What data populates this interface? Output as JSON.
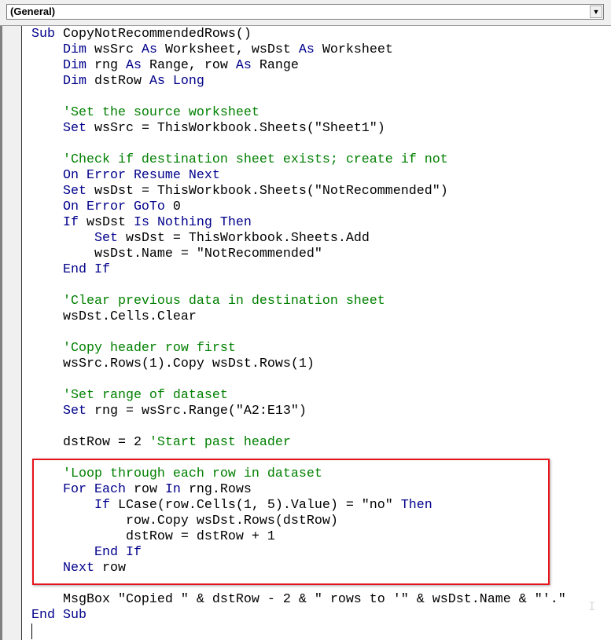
{
  "procedure_dropdown": {
    "selected": "(General)"
  },
  "code_lines": [
    [
      {
        "t": "Sub ",
        "c": "kw"
      },
      {
        "t": "CopyNotRecommendedRows()",
        "c": "tx"
      }
    ],
    [
      {
        "t": "    Dim ",
        "c": "kw"
      },
      {
        "t": "wsSrc ",
        "c": "tx"
      },
      {
        "t": "As ",
        "c": "kw"
      },
      {
        "t": "Worksheet, wsDst ",
        "c": "tx"
      },
      {
        "t": "As ",
        "c": "kw"
      },
      {
        "t": "Worksheet",
        "c": "tx"
      }
    ],
    [
      {
        "t": "    Dim ",
        "c": "kw"
      },
      {
        "t": "rng ",
        "c": "tx"
      },
      {
        "t": "As ",
        "c": "kw"
      },
      {
        "t": "Range, row ",
        "c": "tx"
      },
      {
        "t": "As ",
        "c": "kw"
      },
      {
        "t": "Range",
        "c": "tx"
      }
    ],
    [
      {
        "t": "    Dim ",
        "c": "kw"
      },
      {
        "t": "dstRow ",
        "c": "tx"
      },
      {
        "t": "As Long",
        "c": "kw"
      }
    ],
    [],
    [
      {
        "t": "    'Set the source worksheet",
        "c": "cm"
      }
    ],
    [
      {
        "t": "    Set ",
        "c": "kw"
      },
      {
        "t": "wsSrc = ThisWorkbook.Sheets(\"Sheet1\")",
        "c": "tx"
      }
    ],
    [],
    [
      {
        "t": "    'Check if destination sheet exists; create if not",
        "c": "cm"
      }
    ],
    [
      {
        "t": "    On Error Resume Next",
        "c": "kw"
      }
    ],
    [
      {
        "t": "    Set ",
        "c": "kw"
      },
      {
        "t": "wsDst = ThisWorkbook.Sheets(\"NotRecommended\")",
        "c": "tx"
      }
    ],
    [
      {
        "t": "    On Error GoTo ",
        "c": "kw"
      },
      {
        "t": "0",
        "c": "tx"
      }
    ],
    [
      {
        "t": "    If ",
        "c": "kw"
      },
      {
        "t": "wsDst ",
        "c": "tx"
      },
      {
        "t": "Is Nothing Then",
        "c": "kw"
      }
    ],
    [
      {
        "t": "        Set ",
        "c": "kw"
      },
      {
        "t": "wsDst = ThisWorkbook.Sheets.Add",
        "c": "tx"
      }
    ],
    [
      {
        "t": "        wsDst.Name = \"NotRecommended\"",
        "c": "tx"
      }
    ],
    [
      {
        "t": "    End If",
        "c": "kw"
      }
    ],
    [],
    [
      {
        "t": "    'Clear previous data in destination sheet",
        "c": "cm"
      }
    ],
    [
      {
        "t": "    wsDst.Cells.Clear",
        "c": "tx"
      }
    ],
    [],
    [
      {
        "t": "    'Copy header row first",
        "c": "cm"
      }
    ],
    [
      {
        "t": "    wsSrc.Rows(1).Copy wsDst.Rows(1)",
        "c": "tx"
      }
    ],
    [],
    [
      {
        "t": "    'Set range of dataset",
        "c": "cm"
      }
    ],
    [
      {
        "t": "    Set ",
        "c": "kw"
      },
      {
        "t": "rng = wsSrc.Range(\"A2:E13\")",
        "c": "tx"
      }
    ],
    [],
    [
      {
        "t": "    dstRow = 2 ",
        "c": "tx"
      },
      {
        "t": "'Start past header",
        "c": "cm"
      }
    ],
    [],
    [
      {
        "t": "    'Loop through each row in dataset",
        "c": "cm"
      }
    ],
    [
      {
        "t": "    For Each ",
        "c": "kw"
      },
      {
        "t": "row ",
        "c": "tx"
      },
      {
        "t": "In ",
        "c": "kw"
      },
      {
        "t": "rng.Rows",
        "c": "tx"
      }
    ],
    [
      {
        "t": "        If ",
        "c": "kw"
      },
      {
        "t": "LCase(row.Cells(1, 5).Value) = \"no\" ",
        "c": "tx"
      },
      {
        "t": "Then",
        "c": "kw"
      }
    ],
    [
      {
        "t": "            row.Copy wsDst.Rows(dstRow)",
        "c": "tx"
      }
    ],
    [
      {
        "t": "            dstRow = dstRow + 1",
        "c": "tx"
      }
    ],
    [
      {
        "t": "        End If",
        "c": "kw"
      }
    ],
    [
      {
        "t": "    Next ",
        "c": "kw"
      },
      {
        "t": "row",
        "c": "tx"
      }
    ],
    [],
    [
      {
        "t": "    MsgBox \"Copied \" & dstRow - 2 & \" rows to '\" & wsDst.Name & \"'.\"",
        "c": "tx"
      }
    ],
    [
      {
        "t": "End Sub",
        "c": "kw"
      }
    ]
  ],
  "colors": {
    "keyword": "#00008b",
    "comment": "#008000",
    "highlight_box": "#e8141b"
  }
}
